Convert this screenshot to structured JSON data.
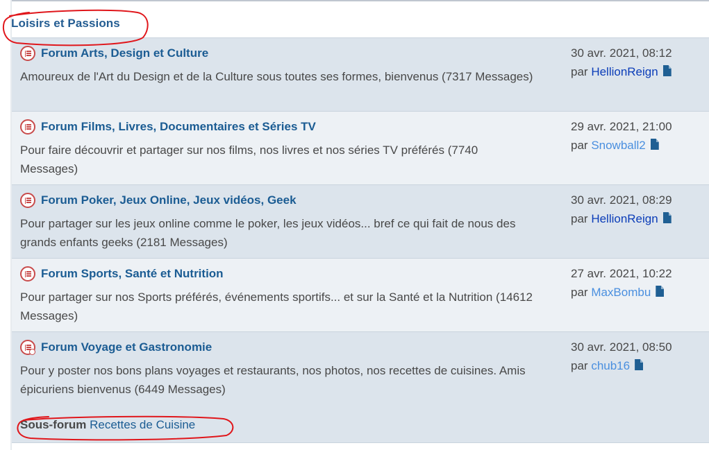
{
  "category": {
    "title": "Loisirs et Passions"
  },
  "forums": [
    {
      "title": "Forum Arts, Design et Culture",
      "description": "Amoureux de l'Art du Design et de la Culture sous toutes ses formes, bienvenus (7317 Messages)",
      "last_post_date": "30 avr. 2021, 08:12",
      "by_label": "par",
      "author": "HellionReign",
      "author_color": "#0a3cb8"
    },
    {
      "title": "Forum Films, Livres, Documentaires et Séries TV",
      "description": "Pour faire découvrir et partager sur nos films, nos livres et nos séries TV préférés (7740 Messages)",
      "last_post_date": "29 avr. 2021, 21:00",
      "by_label": "par",
      "author": "Snowball2",
      "author_color": "#4a8fdf"
    },
    {
      "title": "Forum Poker, Jeux Online, Jeux vidéos, Geek",
      "description": "Pour partager sur les jeux online comme le poker, les jeux vidéos... bref ce qui fait de nous des grands enfants geeks (2181 Messages)",
      "last_post_date": "30 avr. 2021, 08:29",
      "by_label": "par",
      "author": "HellionReign",
      "author_color": "#0a3cb8"
    },
    {
      "title": "Forum Sports, Santé et Nutrition",
      "description": "Pour partager sur nos Sports préférés, événements sportifs... et sur la Santé et la Nutrition (14612 Messages)",
      "last_post_date": "27 avr. 2021, 10:22",
      "by_label": "par",
      "author": "MaxBombu",
      "author_color": "#4a8fdf"
    },
    {
      "title": "Forum Voyage et Gastronomie",
      "description": "Pour y poster nos bons plans voyages et restaurants, nos photos, nos recettes de cuisines. Amis épicuriens bienvenus (6449 Messages)",
      "last_post_date": "30 avr. 2021, 08:50",
      "by_label": "par",
      "author": "chub16",
      "author_color": "#4a8fdf",
      "subforum_label": "Sous-forum",
      "subforum_link": "Recettes de Cuisine"
    }
  ],
  "colors": {
    "link": "#1b5c93",
    "row_odd": "#dce4ec",
    "row_even": "#edf1f5",
    "forum_icon": "#c84a4a",
    "annotation": "#e0161b"
  },
  "icons": {
    "forum": "forum-read-icon",
    "forum_subforum": "forum-read-subforum-icon",
    "last_post": "file-icon"
  }
}
